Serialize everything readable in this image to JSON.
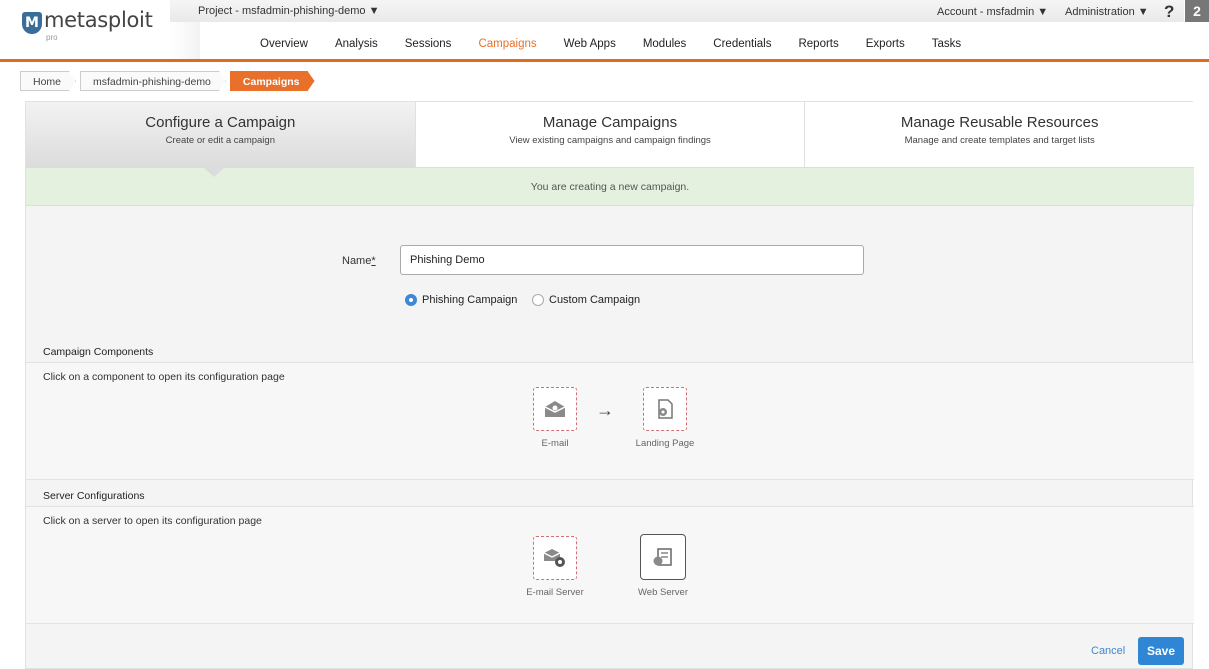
{
  "header": {
    "logo_text": "metasploit",
    "logo_sub": "pro",
    "project_menu": "Project - msfadmin-phishing-demo ▼",
    "account_menu": "Account - msfadmin ▼",
    "admin_menu": "Administration ▼",
    "help": "?",
    "badge": "2"
  },
  "nav": {
    "items": [
      "Overview",
      "Analysis",
      "Sessions",
      "Campaigns",
      "Web Apps",
      "Modules",
      "Credentials",
      "Reports",
      "Exports",
      "Tasks"
    ],
    "active": "Campaigns"
  },
  "breadcrumb": [
    "Home",
    "msfadmin-phishing-demo",
    "Campaigns"
  ],
  "tabs": [
    {
      "title": "Configure a Campaign",
      "subtitle": "Create or edit a campaign"
    },
    {
      "title": "Manage Campaigns",
      "subtitle": "View existing campaigns and campaign findings"
    },
    {
      "title": "Manage Reusable Resources",
      "subtitle": "Manage and create templates and target lists"
    }
  ],
  "notice": "You are creating a new campaign.",
  "form": {
    "name_label": "Name",
    "name_required": "*",
    "name_value": "Phishing Demo",
    "radio_phishing": "Phishing Campaign",
    "radio_custom": "Custom Campaign",
    "selected_type": "Phishing Campaign"
  },
  "components": {
    "heading": "Campaign Components",
    "description": "Click on a component to open its configuration page",
    "arrow": "→",
    "email_label": "E-mail",
    "landing_label": "Landing Page"
  },
  "servers": {
    "heading": "Server Configurations",
    "description": "Click on a server to open its configuration page",
    "email_server_label": "E-mail Server",
    "web_server_label": "Web Server"
  },
  "actions": {
    "cancel": "Cancel",
    "save": "Save"
  },
  "colors": {
    "accent": "#e8702a",
    "primary_button": "#2f86d4",
    "notice_bg": "#e4f1df"
  }
}
